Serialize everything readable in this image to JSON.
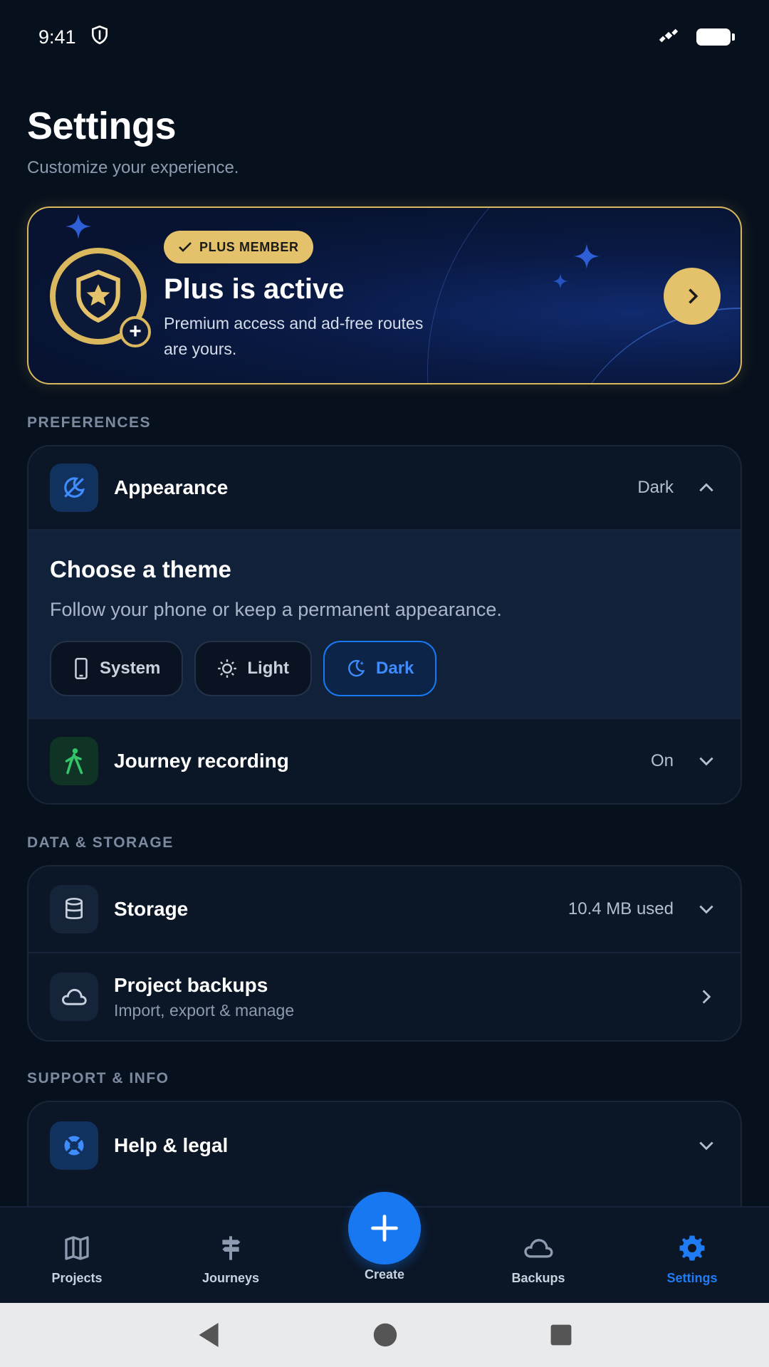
{
  "status_bar": {
    "time": "9:41"
  },
  "header": {
    "title": "Settings",
    "subtitle": "Customize your experience."
  },
  "plus_card": {
    "badge": "PLUS MEMBER",
    "title": "Plus is active",
    "description": "Premium access and ad-free routes are yours.",
    "accent": "#e3c26b"
  },
  "sections": {
    "preferences": "PREFERENCES",
    "data_storage": "DATA & STORAGE",
    "support_info": "SUPPORT & INFO"
  },
  "appearance": {
    "label": "Appearance",
    "value": "Dark",
    "panel_title": "Choose a theme",
    "panel_desc": "Follow your phone or keep a permanent appearance.",
    "options": [
      {
        "label": "System",
        "icon": "phone-icon"
      },
      {
        "label": "Light",
        "icon": "sun-icon"
      },
      {
        "label": "Dark",
        "icon": "moon-icon",
        "selected": true
      }
    ]
  },
  "journey": {
    "label": "Journey recording",
    "value": "On"
  },
  "storage": {
    "label": "Storage",
    "value": "10.4 MB used"
  },
  "backups": {
    "label": "Project backups",
    "sub": "Import, export & manage"
  },
  "help": {
    "label": "Help & legal"
  },
  "nav": {
    "projects": "Projects",
    "journeys": "Journeys",
    "create": "Create",
    "backups": "Backups",
    "settings": "Settings",
    "active": "Settings",
    "active_color": "#1f7cf5"
  }
}
